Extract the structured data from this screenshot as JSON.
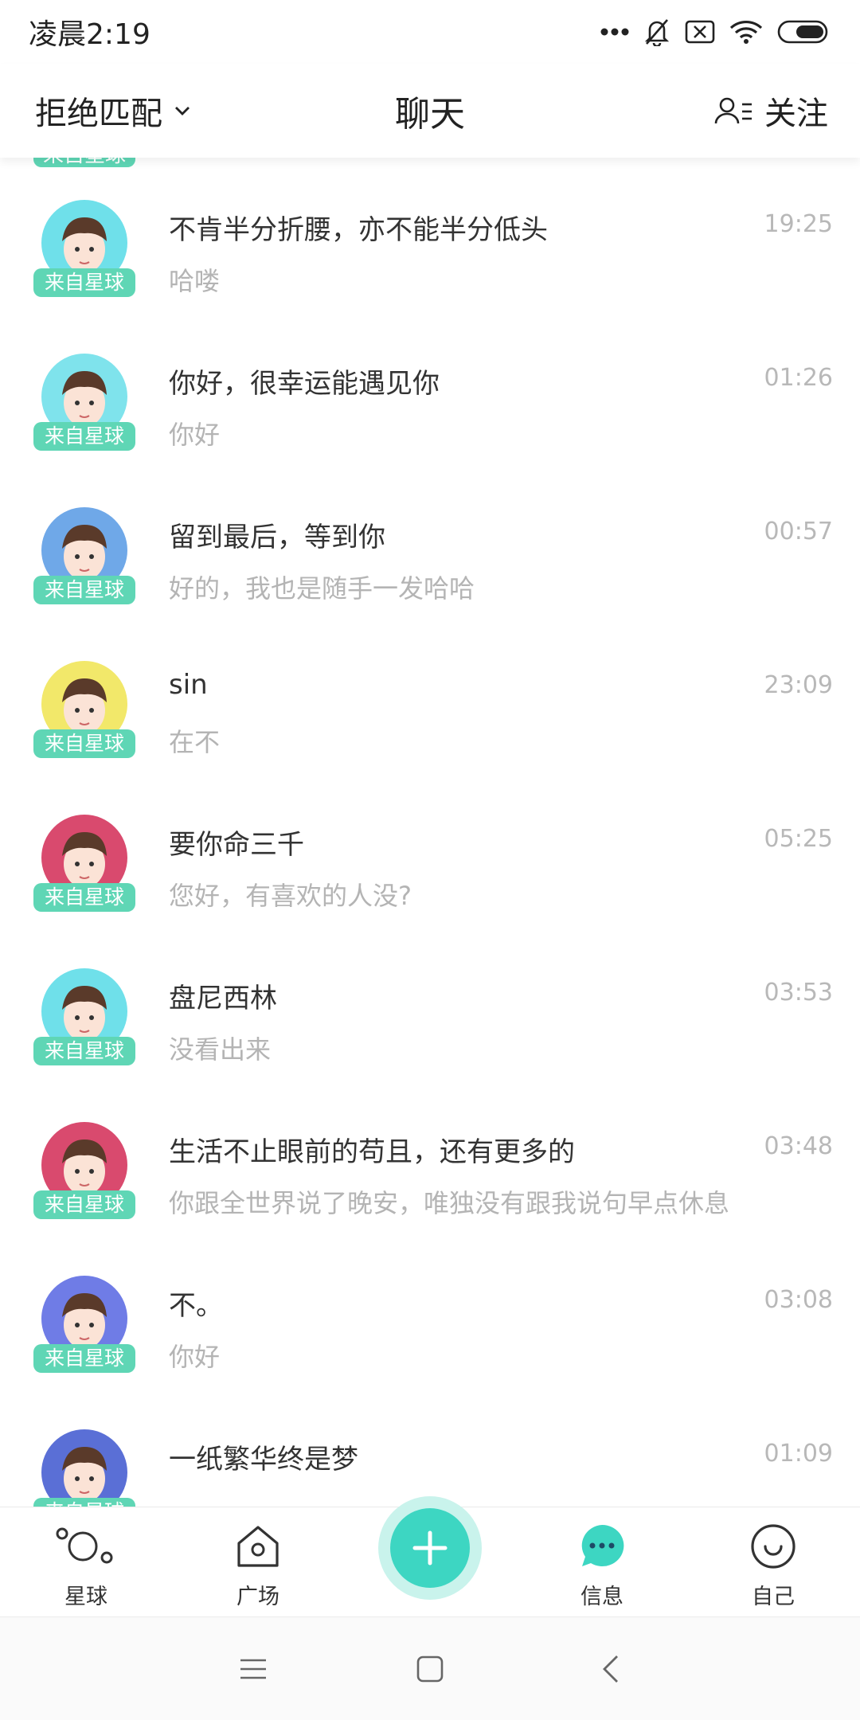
{
  "status_bar": {
    "time": "凌晨2:19"
  },
  "header": {
    "match_label": "拒绝匹配",
    "title": "聊天",
    "follow_label": "关注"
  },
  "badge_label": "来自星球",
  "chats": [
    {
      "name": "不肯半分折腰，亦不能半分低头",
      "time": "19:25",
      "preview": "哈喽",
      "avatar_bg": "#6fe0ea"
    },
    {
      "name": "你好，很幸运能遇见你",
      "time": "01:26",
      "preview": "你好",
      "avatar_bg": "#7fe3ec"
    },
    {
      "name": "留到最后，等到你",
      "time": "00:57",
      "preview": "好的，我也是随手一发哈哈",
      "avatar_bg": "#6fa8e8"
    },
    {
      "name": "sin",
      "time": "23:09",
      "preview": "在不",
      "avatar_bg": "#f2e86a"
    },
    {
      "name": "要你命三千",
      "time": "05:25",
      "preview": "您好，有喜欢的人没?",
      "avatar_bg": "#d94a6e"
    },
    {
      "name": "盘尼西林",
      "time": "03:53",
      "preview": "没看出来",
      "avatar_bg": "#6fe0ea"
    },
    {
      "name": "生活不止眼前的苟且，还有更多的",
      "time": "03:48",
      "preview": "你跟全世界说了晚安，唯独没有跟我说句早点休息",
      "avatar_bg": "#d94a6e"
    },
    {
      "name": "不。",
      "time": "03:08",
      "preview": "你好",
      "avatar_bg": "#6f7ce6"
    },
    {
      "name": "一纸繁华终是梦",
      "time": "01:09",
      "preview": "",
      "avatar_bg": "#5a6fd6"
    }
  ],
  "tabs": {
    "planet": "星球",
    "square": "广场",
    "messages": "信息",
    "me": "自己"
  },
  "colors": {
    "accent": "#3dd6c2",
    "badge": "#5fd6b5"
  }
}
